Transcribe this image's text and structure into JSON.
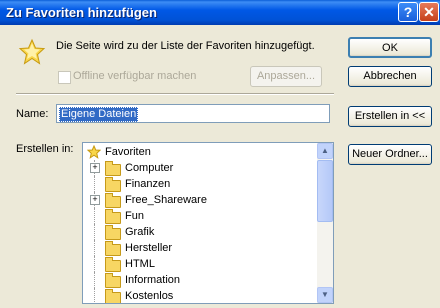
{
  "window": {
    "title": "Zu Favoriten hinzufügen",
    "help_label": "?",
    "close_label": "✕"
  },
  "dialog": {
    "message": "Die Seite wird zu der Liste der Favoriten hinzugefügt.",
    "offline_label": "Offline verfügbar machen",
    "customize_label": "Anpassen...",
    "name_label": "Name:",
    "name_value": "Eigene Dateien",
    "create_in_label": "Erstellen in:"
  },
  "buttons": {
    "ok": "OK",
    "cancel": "Abbrechen",
    "create_in": "Erstellen in <<",
    "new_folder": "Neuer Ordner..."
  },
  "tree": {
    "root": "Favoriten",
    "items": [
      {
        "label": "Computer",
        "expandable": true
      },
      {
        "label": "Finanzen",
        "expandable": false
      },
      {
        "label": "Free_Shareware",
        "expandable": true
      },
      {
        "label": "Fun",
        "expandable": false
      },
      {
        "label": "Grafik",
        "expandable": false
      },
      {
        "label": "Hersteller",
        "expandable": false
      },
      {
        "label": "HTML",
        "expandable": false
      },
      {
        "label": "Information",
        "expandable": false
      },
      {
        "label": "Kostenlos",
        "expandable": false
      }
    ]
  },
  "colors": {
    "titlebar": "#0058e6",
    "selection": "#316ac5",
    "dialog_bg": "#ece9d8"
  },
  "icons": {
    "star": "star-icon",
    "folder": "folder-icon"
  }
}
